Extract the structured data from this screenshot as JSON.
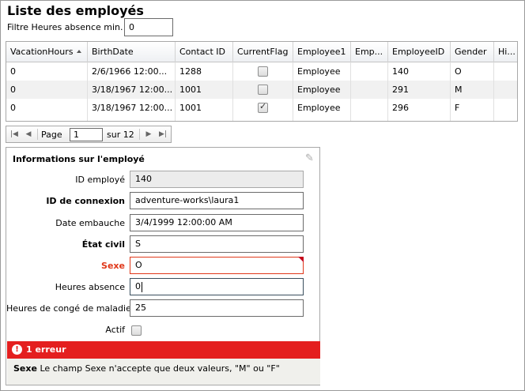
{
  "page": {
    "title": "Liste des employés",
    "filter_label": "Filtre Heures absence min.",
    "filter_value": "0"
  },
  "grid": {
    "columns": [
      "VacationHours",
      "BirthDate",
      "Contact ID",
      "CurrentFlag",
      "Employee1",
      "Emp...",
      "EmployeeID",
      "Gender",
      "Hi..."
    ],
    "sorted_column": "VacationHours",
    "rows": [
      {
        "vacation": "0",
        "birth": "2/6/1966 12:00...",
        "contact": "1288",
        "current": false,
        "employee1": "Employee",
        "emp": "",
        "id": "140",
        "gender": "O"
      },
      {
        "vacation": "0",
        "birth": "3/18/1967 12:00...",
        "contact": "1001",
        "current": false,
        "employee1": "Employee",
        "emp": "",
        "id": "291",
        "gender": "M"
      },
      {
        "vacation": "0",
        "birth": "3/18/1967 12:00...",
        "contact": "1001",
        "current": true,
        "employee1": "Employee",
        "emp": "",
        "id": "296",
        "gender": "F"
      }
    ]
  },
  "pager": {
    "page_label": "Page",
    "page_value": "1",
    "of_label": "sur 12"
  },
  "details": {
    "title": "Informations sur l'employé",
    "fields": {
      "id": {
        "label": "ID employé",
        "value": "140"
      },
      "login": {
        "label": "ID de connexion",
        "value": "adventure-works\\laura1"
      },
      "hire": {
        "label": "Date embauche",
        "value": "3/4/1999 12:00:00 AM"
      },
      "marital": {
        "label": "État civil",
        "value": "S"
      },
      "gender": {
        "label": "Sexe",
        "value": "O"
      },
      "absence": {
        "label": "Heures absence",
        "value": "0"
      },
      "sick": {
        "label": "Heures de congé de maladie",
        "value": "25"
      },
      "active": {
        "label": "Actif",
        "checked": false
      }
    },
    "error_summary": "1 erreur",
    "error_field": "Sexe",
    "error_message": "Le champ Sexe n'accepte que deux valeurs, \"M\" ou \"F\""
  },
  "colors": {
    "error": "#e41f1f",
    "error_label": "#e0381a"
  },
  "icons": [
    "sort-ascending-icon",
    "first-page-icon",
    "previous-page-icon",
    "next-page-icon",
    "last-page-icon",
    "edit-pencil-icon",
    "error-icon",
    "checkbox-icon"
  ]
}
